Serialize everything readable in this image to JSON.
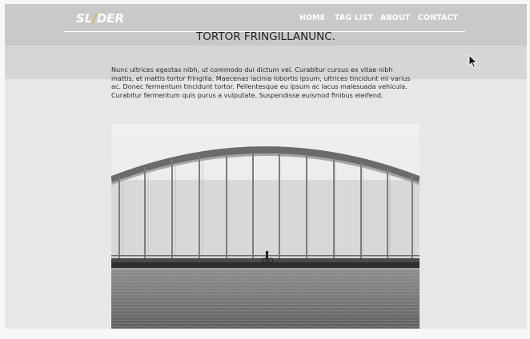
{
  "header": {
    "logo_text_before": "SL",
    "logo_text_slash": "/",
    "logo_text_after": "DER",
    "nav": [
      {
        "label": "HOME"
      },
      {
        "label": "TAG LIST"
      },
      {
        "label": "ABOUT"
      },
      {
        "label": "CONTACT"
      }
    ]
  },
  "article": {
    "title": "TORTOR FRINGILLANUNC.",
    "body": "Nunc ultrices egestas nibh, ut commodo dui dictum vel. Curabitur cursus ex vitae nibh mattis, et mattis tortor fringilla. Maecenas lacinia lobortis ipsum, ultrices tincidunt mi varius ac. Donec fermentum tincidunt tortor. Pellentesque eu ipsum ac lacus malesuada vehicula. Curabitur fermentum quis purus a vulputate. Suspendisse euismod finibus eleifend."
  },
  "colors": {
    "header_bg": "#c9c9c9",
    "page_bg": "#e7e7e7",
    "logo_accent": "#e3b23c",
    "nav_text": "#ffffff"
  },
  "icons": {
    "cursor": "mouse-pointer-icon"
  }
}
